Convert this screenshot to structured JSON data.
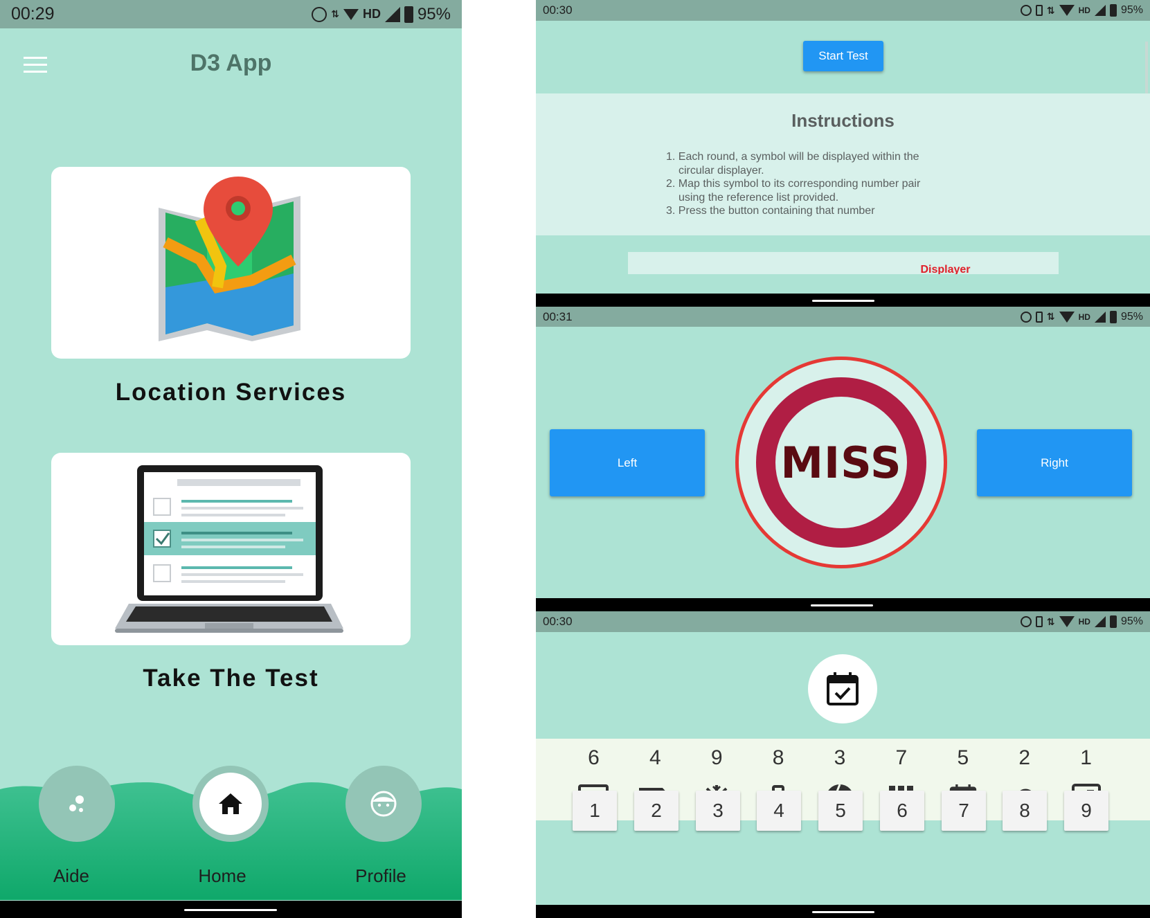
{
  "colors": {
    "bg_mint": "#ade3d4",
    "status_bar": "#84ab9f",
    "accent_blue": "#2196f3",
    "miss_red": "#b01e44",
    "green_wave": "#2fb87e"
  },
  "left": {
    "status": {
      "time": "00:29",
      "hd": "HD",
      "battery": "95%"
    },
    "app_title": "D3 App",
    "cards": [
      {
        "label": "Location Services",
        "icon": "map-pin-icon"
      },
      {
        "label": "Take The Test",
        "icon": "laptop-checklist-icon"
      }
    ],
    "nav": [
      {
        "label": "Aide",
        "icon": "bubbles-icon"
      },
      {
        "label": "Home",
        "icon": "home-icon"
      },
      {
        "label": "Profile",
        "icon": "face-icon"
      }
    ]
  },
  "screen1": {
    "status": {
      "time": "00:30",
      "hd": "HD",
      "battery": "95%"
    },
    "start_button": "Start Test",
    "instructions_title": "Instructions",
    "instructions": [
      "1. Each round, a symbol will be displayed within the",
      "circular displayer.",
      "2. Map this symbol to its corresponding number pair",
      "using the reference list provided.",
      "3. Press the button containing that number"
    ],
    "displayer_label": "Displayer"
  },
  "screen2": {
    "status": {
      "time": "00:31",
      "hd": "HD",
      "battery": "95%"
    },
    "left_button": "Left",
    "right_button": "Right",
    "result_text": "MISS"
  },
  "screen3": {
    "status": {
      "time": "00:30",
      "hd": "HD",
      "battery": "95%"
    },
    "current_symbol": "calendar-check-icon",
    "reference_numbers": [
      "6",
      "4",
      "9",
      "8",
      "3",
      "7",
      "5",
      "2",
      "1"
    ],
    "reference_symbols": [
      "list-screen-icon",
      "van-icon",
      "snowflake-icon",
      "briefcase-icon",
      "aperture-icon",
      "grid-icon",
      "calendar-check-icon",
      "cloud-icon",
      "nfc-icon"
    ],
    "keypad": [
      "1",
      "2",
      "3",
      "4",
      "5",
      "6",
      "7",
      "8",
      "9"
    ]
  }
}
